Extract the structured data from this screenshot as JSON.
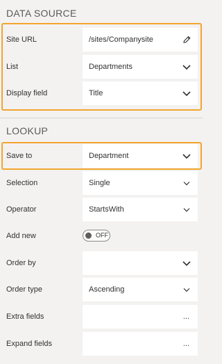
{
  "data_source": {
    "title": "DATA SOURCE",
    "site_url_label": "Site URL",
    "site_url_value": "/sites/Companysite",
    "list_label": "List",
    "list_value": "Departments",
    "display_field_label": "Display field",
    "display_field_value": "Title"
  },
  "lookup": {
    "title": "LOOKUP",
    "save_to_label": "Save to",
    "save_to_value": "Department",
    "selection_label": "Selection",
    "selection_value": "Single",
    "operator_label": "Operator",
    "operator_value": "StartsWith",
    "add_new_label": "Add new",
    "add_new_toggle": "OFF",
    "order_by_label": "Order by",
    "order_by_value": "",
    "order_type_label": "Order type",
    "order_type_value": "Ascending",
    "extra_fields_label": "Extra fields",
    "extra_fields_button": "...",
    "expand_fields_label": "Expand fields",
    "expand_fields_button": "..."
  },
  "colors": {
    "highlight": "#f2a52d",
    "background": "#f3f2f1",
    "field": "#ffffff"
  },
  "icons": [
    "pencil-icon",
    "chevron-down-icon",
    "ellipsis-icon"
  ]
}
